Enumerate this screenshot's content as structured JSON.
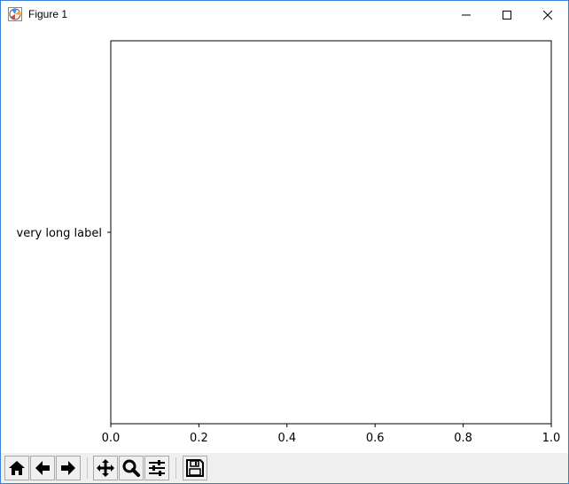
{
  "window": {
    "title": "Figure 1"
  },
  "toolbar": {
    "buttons": [
      {
        "name": "home-button",
        "icon": "home-icon"
      },
      {
        "name": "back-button",
        "icon": "arrow-left-icon"
      },
      {
        "name": "forward-button",
        "icon": "arrow-right-icon"
      },
      {
        "name": "pan-button",
        "icon": "move-icon"
      },
      {
        "name": "zoom-button",
        "icon": "magnifier-icon"
      },
      {
        "name": "configure-subplots-button",
        "icon": "sliders-icon"
      },
      {
        "name": "save-button",
        "icon": "floppy-disk-icon"
      }
    ]
  },
  "chart_data": {
    "type": "bar",
    "title": "",
    "xlabel": "",
    "ylabel": "",
    "orientation": "horizontal",
    "categories": [
      "very long label"
    ],
    "values": [],
    "xlim": [
      0.0,
      1.0
    ],
    "xticks": [
      "0.0",
      "0.2",
      "0.4",
      "0.6",
      "0.8",
      "1.0"
    ],
    "grid": false
  }
}
